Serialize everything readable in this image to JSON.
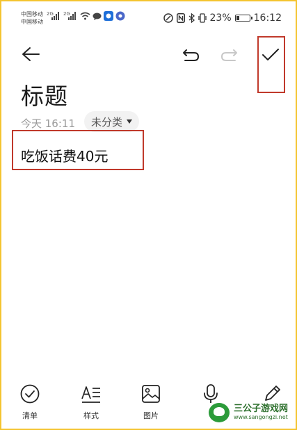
{
  "status": {
    "carrier1": "中国移动",
    "carrier2": "中国移动",
    "net1": "2G",
    "net2": "2G",
    "battery_pct_text": "23%",
    "battery_level": 0.23,
    "time": "16:12"
  },
  "header": {
    "back_icon": "arrow-left-icon",
    "undo_icon": "undo-icon",
    "redo_icon": "redo-icon",
    "confirm_icon": "check-icon"
  },
  "note": {
    "title_placeholder": "标题",
    "date": "今天 16:11",
    "category": "未分类",
    "content": "吃饭话费40元"
  },
  "toolbar": {
    "items": [
      {
        "label": "清单",
        "icon": "checklist-icon"
      },
      {
        "label": "样式",
        "icon": "text-style-icon"
      },
      {
        "label": "图片",
        "icon": "image-icon"
      },
      {
        "label": "",
        "icon": "microphone-icon"
      },
      {
        "label": "",
        "icon": "pen-icon"
      }
    ]
  },
  "watermark": {
    "title": "三公子游戏网",
    "url": "www.sangongzi.net"
  },
  "colors": {
    "highlight": "#c0392b",
    "frame": "#f4c430",
    "watermark": "#2c6f2c"
  }
}
